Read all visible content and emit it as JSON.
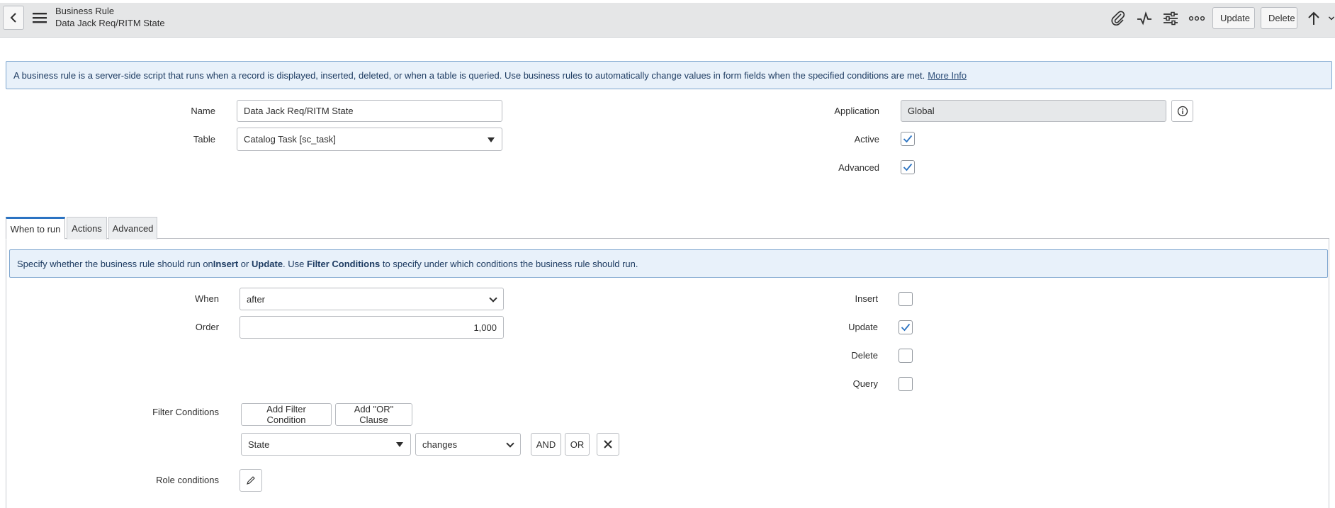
{
  "header": {
    "title": "Business Rule",
    "subtitle": "Data Jack Req/RITM State",
    "update_label": "Update",
    "delete_label": "Delete"
  },
  "info_banner": {
    "text": "A business rule is a server-side script that runs when a record is displayed, inserted, deleted, or when a table is queried. Use business rules to automatically change values in form fields when the specified conditions are met.",
    "link": "More Info"
  },
  "form": {
    "name_label": "Name",
    "name_value": "Data Jack Req/RITM State",
    "table_label": "Table",
    "table_value": "Catalog Task [sc_task]",
    "application_label": "Application",
    "application_value": "Global",
    "active_label": "Active",
    "active_checked": true,
    "advanced_label": "Advanced",
    "advanced_checked": true
  },
  "tabs": [
    {
      "label": "When to run",
      "active": true
    },
    {
      "label": "Actions",
      "active": false
    },
    {
      "label": "Advanced",
      "active": false
    }
  ],
  "when_banner": {
    "p1": "Specify whether the business rule should run on ",
    "b1": "Insert",
    "p2": " or ",
    "b2": "Update",
    "p3": ". Use ",
    "b3": "Filter Conditions",
    "p4": " to specify under which conditions the business rule should run."
  },
  "when_to_run": {
    "when_label": "When",
    "when_value": "after",
    "order_label": "Order",
    "order_value": "1,000",
    "insert_label": "Insert",
    "insert_checked": false,
    "update_label": "Update",
    "update_checked": true,
    "delete_label": "Delete",
    "delete_checked": false,
    "query_label": "Query",
    "query_checked": false,
    "filter_label": "Filter Conditions",
    "add_filter_label": "Add Filter Condition",
    "add_or_label": "Add \"OR\" Clause",
    "condition_field": "State",
    "condition_operator": "changes",
    "and_label": "AND",
    "or_label": "OR",
    "role_label": "Role conditions"
  },
  "colors": {
    "accent": "#2b73c2",
    "header_bg": "#e5e6e7",
    "banner_bg": "#e8f1fa",
    "banner_border": "#7ea6cf"
  },
  "icons": [
    "back-icon",
    "menu-icon",
    "attachment-icon",
    "activity-icon",
    "settings-sliders-icon",
    "more-icon",
    "arrow-up-icon",
    "chevron-down-icon",
    "info-icon",
    "check-icon",
    "close-icon",
    "pencil-icon"
  ]
}
